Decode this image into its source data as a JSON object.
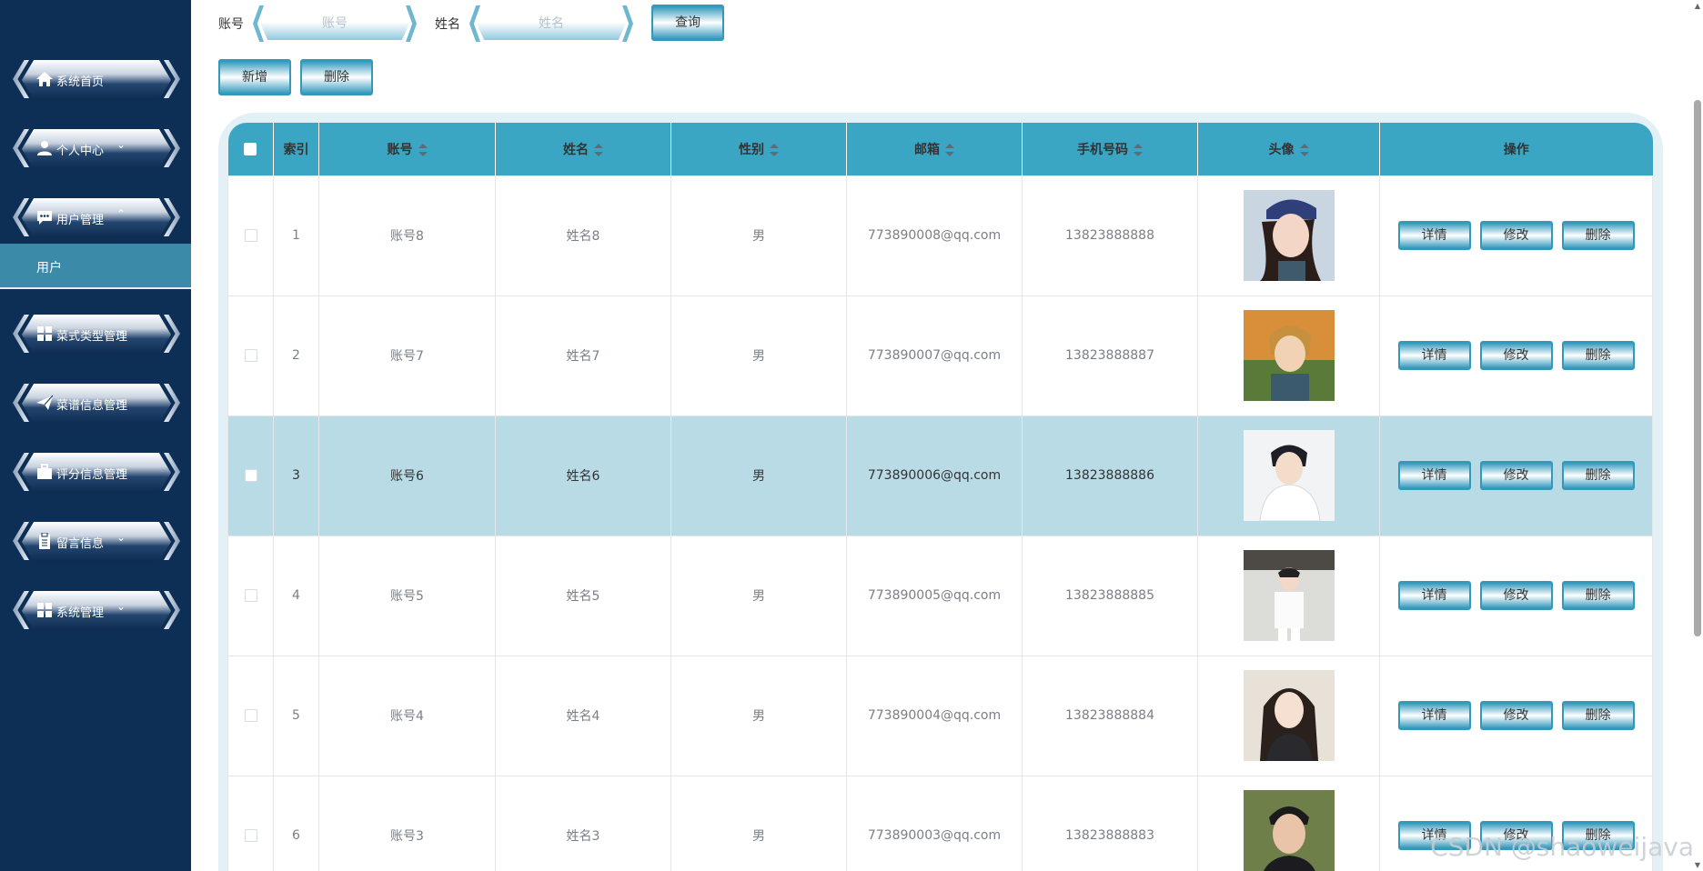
{
  "sidebar": {
    "items": [
      {
        "label": "系统首页",
        "icon": "home-icon",
        "chevron": ""
      },
      {
        "label": "个人中心",
        "icon": "user-icon",
        "chevron": "⌄"
      },
      {
        "label": "用户管理",
        "icon": "message-icon",
        "chevron": "⌃"
      },
      {
        "label": "菜式类型管理",
        "icon": "grid-icon",
        "chevron": "⌄"
      },
      {
        "label": "菜谱信息管理",
        "icon": "send-icon",
        "chevron": "⌄"
      },
      {
        "label": "评分信息管理",
        "icon": "briefcase-icon",
        "chevron": "⌄"
      },
      {
        "label": "留言信息",
        "icon": "clipboard-icon",
        "chevron": "⌄"
      },
      {
        "label": "系统管理",
        "icon": "grid-icon",
        "chevron": "⌄"
      }
    ],
    "submenu_label": "用户"
  },
  "search": {
    "account_label": "账号",
    "account_placeholder": "账号",
    "name_label": "姓名",
    "name_placeholder": "姓名",
    "query_button": "查询"
  },
  "actions": {
    "add_button": "新增",
    "delete_button": "删除"
  },
  "table": {
    "headers": [
      "索引",
      "账号",
      "姓名",
      "性别",
      "邮箱",
      "手机号码",
      "头像",
      "操作"
    ],
    "rows": [
      {
        "index": "1",
        "account": "账号8",
        "name": "姓名8",
        "gender": "男",
        "email": "773890008@qq.com",
        "phone": "13823888888"
      },
      {
        "index": "2",
        "account": "账号7",
        "name": "姓名7",
        "gender": "男",
        "email": "773890007@qq.com",
        "phone": "13823888887"
      },
      {
        "index": "3",
        "account": "账号6",
        "name": "姓名6",
        "gender": "男",
        "email": "773890006@qq.com",
        "phone": "13823888886"
      },
      {
        "index": "4",
        "account": "账号5",
        "name": "姓名5",
        "gender": "男",
        "email": "773890005@qq.com",
        "phone": "13823888885"
      },
      {
        "index": "5",
        "account": "账号4",
        "name": "姓名4",
        "gender": "男",
        "email": "773890004@qq.com",
        "phone": "13823888884"
      },
      {
        "index": "6",
        "account": "账号3",
        "name": "姓名3",
        "gender": "男",
        "email": "773890003@qq.com",
        "phone": "13823888883"
      }
    ],
    "row_buttons": {
      "detail": "详情",
      "edit": "修改",
      "delete": "删除"
    }
  },
  "watermark": "CSDN @shaoweijava",
  "colors": {
    "sidebar_bg": "#0d2f55",
    "header_bg": "#3aa6c4",
    "active_row": "#b8dbe5",
    "submenu_bg": "#3a8aa8"
  }
}
